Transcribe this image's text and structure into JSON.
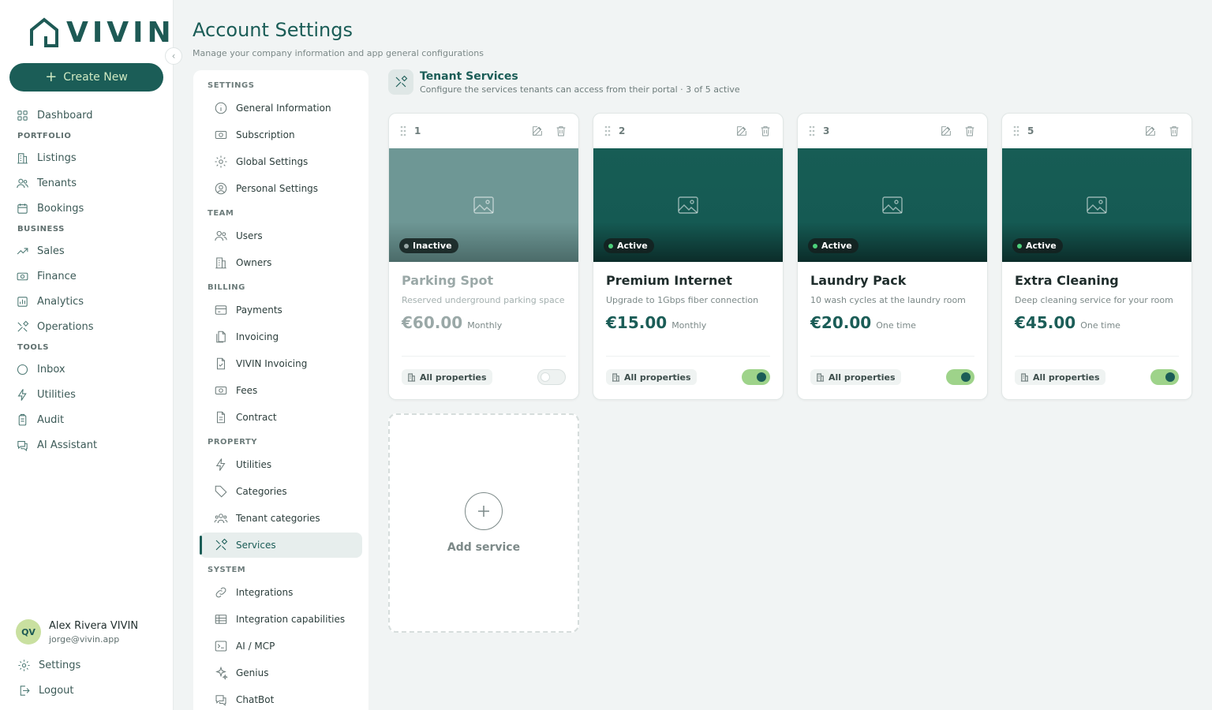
{
  "app": {
    "logo_text": "VIVIN",
    "create_label": "Create New"
  },
  "sidebar": {
    "items": [
      {
        "type": "item",
        "label": "Dashboard",
        "icon": "grid-icon"
      },
      {
        "type": "section",
        "label": "PORTFOLIO"
      },
      {
        "type": "item",
        "label": "Listings",
        "icon": "building-icon"
      },
      {
        "type": "item",
        "label": "Tenants",
        "icon": "users-icon"
      },
      {
        "type": "item",
        "label": "Bookings",
        "icon": "calendar-icon"
      },
      {
        "type": "section",
        "label": "BUSINESS"
      },
      {
        "type": "item",
        "label": "Sales",
        "icon": "trend-icon"
      },
      {
        "type": "item",
        "label": "Finance",
        "icon": "money-icon"
      },
      {
        "type": "item",
        "label": "Analytics",
        "icon": "chart-icon"
      },
      {
        "type": "item",
        "label": "Operations",
        "icon": "tools-icon"
      },
      {
        "type": "section",
        "label": "TOOLS"
      },
      {
        "type": "item",
        "label": "Inbox",
        "icon": "chat-icon"
      },
      {
        "type": "item",
        "label": "Utilities",
        "icon": "bolt-icon"
      },
      {
        "type": "item",
        "label": "Audit",
        "icon": "clipboard-icon"
      },
      {
        "type": "item",
        "label": "AI Assistant",
        "icon": "chat-bubbles-icon"
      }
    ],
    "user": {
      "initials": "QV",
      "name": "Alex Rivera VIVIN",
      "email": "jorge@vivin.app"
    },
    "settings_label": "Settings",
    "logout_label": "Logout"
  },
  "header": {
    "title": "Account Settings",
    "subtitle": "Manage your company information and app general configurations"
  },
  "settings_menu": [
    {
      "type": "section",
      "label": "SETTINGS"
    },
    {
      "type": "item",
      "label": "General Information",
      "icon": "info-icon"
    },
    {
      "type": "item",
      "label": "Subscription",
      "icon": "money-icon"
    },
    {
      "type": "item",
      "label": "Global Settings",
      "icon": "gear-icon"
    },
    {
      "type": "item",
      "label": "Personal Settings",
      "icon": "user-circle-icon"
    },
    {
      "type": "section",
      "label": "TEAM"
    },
    {
      "type": "item",
      "label": "Users",
      "icon": "users-icon"
    },
    {
      "type": "item",
      "label": "Owners",
      "icon": "building-icon"
    },
    {
      "type": "section",
      "label": "BILLING"
    },
    {
      "type": "item",
      "label": "Payments",
      "icon": "card-icon"
    },
    {
      "type": "item",
      "label": "Invoicing",
      "icon": "docs-icon"
    },
    {
      "type": "item",
      "label": "VIVIN Invoicing",
      "icon": "doc-check-icon"
    },
    {
      "type": "item",
      "label": "Fees",
      "icon": "money-icon"
    },
    {
      "type": "item",
      "label": "Contract",
      "icon": "doc-icon"
    },
    {
      "type": "section",
      "label": "PROPERTY"
    },
    {
      "type": "item",
      "label": "Utilities",
      "icon": "bolt-icon"
    },
    {
      "type": "item",
      "label": "Categories",
      "icon": "tag-icon"
    },
    {
      "type": "item",
      "label": "Tenant categories",
      "icon": "users-group-icon"
    },
    {
      "type": "item",
      "label": "Services",
      "icon": "tools-icon",
      "active": true
    },
    {
      "type": "section",
      "label": "SYSTEM"
    },
    {
      "type": "item",
      "label": "Integrations",
      "icon": "link-icon"
    },
    {
      "type": "item",
      "label": "Integration capabilities",
      "icon": "table-icon"
    },
    {
      "type": "item",
      "label": "AI / MCP",
      "icon": "terminal-icon"
    },
    {
      "type": "item",
      "label": "Genius",
      "icon": "sparkle-icon"
    },
    {
      "type": "item",
      "label": "ChatBot",
      "icon": "chat-bubbles-icon"
    }
  ],
  "services_section": {
    "title": "Tenant Services",
    "description": "Configure the services tenants can access from their portal · 3 of 5 active"
  },
  "services": [
    {
      "order": "1",
      "title": "Parking Spot",
      "description": "Reserved underground parking space",
      "price": "€60.00",
      "period": "Monthly",
      "status": "Inactive",
      "scope": "All properties",
      "enabled": false
    },
    {
      "order": "2",
      "title": "Premium Internet",
      "description": "Upgrade to 1Gbps fiber connection",
      "price": "€15.00",
      "period": "Monthly",
      "status": "Active",
      "scope": "All properties",
      "enabled": true
    },
    {
      "order": "3",
      "title": "Laundry Pack",
      "description": "10 wash cycles at the laundry room",
      "price": "€20.00",
      "period": "One time",
      "status": "Active",
      "scope": "All properties",
      "enabled": true
    },
    {
      "order": "5",
      "title": "Extra Cleaning",
      "description": "Deep cleaning service for your room",
      "price": "€45.00",
      "period": "One time",
      "status": "Active",
      "scope": "All properties",
      "enabled": true
    }
  ],
  "add_service_label": "Add service",
  "colors": {
    "brand": "#1b5d57",
    "accent_green": "#9ed38a",
    "active_dot": "#4ccf7a",
    "inactive_dot": "#9aa8a7"
  }
}
